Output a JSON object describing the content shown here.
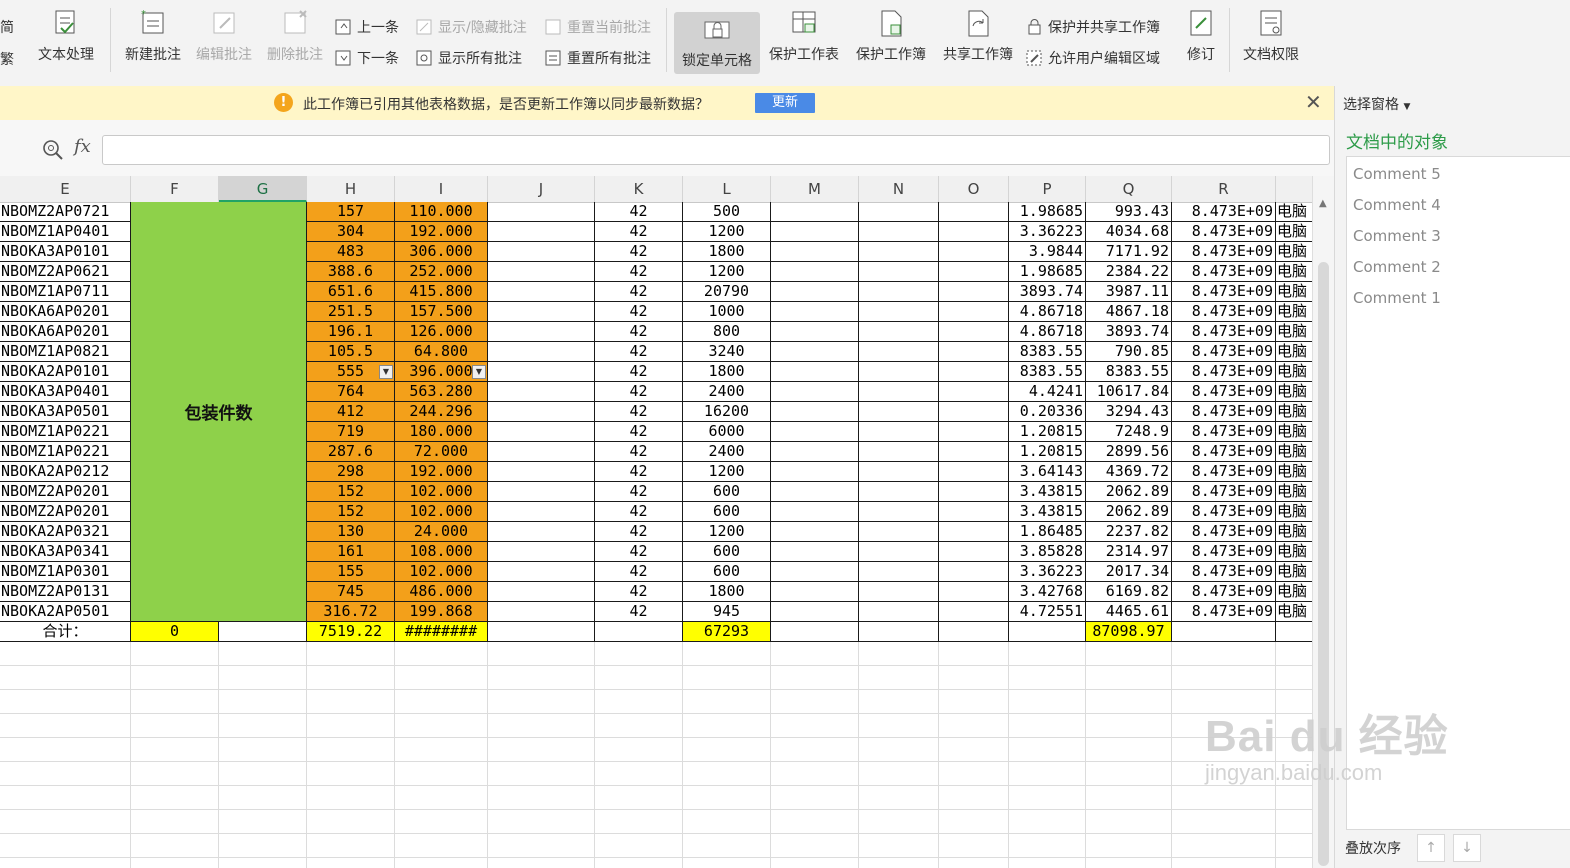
{
  "toolbar": {
    "edge_top": "简",
    "edge_bottom": "繁",
    "text_processing": "文本处理",
    "new_comment": "新建批注",
    "edit_comment": "编辑批注",
    "delete_comment": "删除批注",
    "prev": "上一条",
    "next": "下一条",
    "show_hide_comments": "显示/隐藏批注",
    "show_all_comments": "显示所有批注",
    "reset_current_comment": "重置当前批注",
    "reset_all_comments": "重置所有批注",
    "lock_cells": "锁定单元格",
    "protect_sheet": "保护工作表",
    "protect_workbook": "保护工作簿",
    "share_workbook": "共享工作簿",
    "protect_and_share": "保护并共享工作簿",
    "allow_edit_ranges": "允许用户编辑区域",
    "revise": "修订",
    "doc_permissions": "文档权限"
  },
  "notification": {
    "message": "此工作簿已引用其他表格数据，是否更新工作簿以同步最新数据？",
    "update_button": "更新"
  },
  "formula_bar": {
    "fx": "fx",
    "value": ""
  },
  "columns": [
    "E",
    "F",
    "G",
    "H",
    "I",
    "J",
    "K",
    "L",
    "M",
    "N",
    "O",
    "P",
    "Q",
    "R"
  ],
  "sheet": {
    "merged_label": "包装件数",
    "rows": [
      {
        "e": "NBOMZ2AP0721",
        "h": "157",
        "i": "110.000",
        "k": "42",
        "l": "500",
        "p": "1.98685",
        "q": "993.43",
        "r": "8.473E+09",
        "s": "电脑"
      },
      {
        "e": "NBOMZ1AP0401",
        "h": "304",
        "i": "192.000",
        "k": "42",
        "l": "1200",
        "p": "3.36223",
        "q": "4034.68",
        "r": "8.473E+09",
        "s": "电脑"
      },
      {
        "e": "NBOKA3AP0101",
        "h": "483",
        "i": "306.000",
        "k": "42",
        "l": "1800",
        "p": "3.9844",
        "q": "7171.92",
        "r": "8.473E+09",
        "s": "电脑"
      },
      {
        "e": "NBOMZ2AP0621",
        "h": "388.6",
        "i": "252.000",
        "k": "42",
        "l": "1200",
        "p": "1.98685",
        "q": "2384.22",
        "r": "8.473E+09",
        "s": "电脑"
      },
      {
        "e": "NBOMZ1AP0711",
        "h": "651.6",
        "i": "415.800",
        "k": "42",
        "l": "20790",
        "p": "3893.74",
        "q": "3987.11",
        "r": "8.473E+09",
        "s": "电脑"
      },
      {
        "e": "NBOKA6AP0201",
        "h": "251.5",
        "i": "157.500",
        "k": "42",
        "l": "1000",
        "p": "4.86718",
        "q": "4867.18",
        "r": "8.473E+09",
        "s": "电脑"
      },
      {
        "e": "NBOKA6AP0201",
        "h": "196.1",
        "i": "126.000",
        "k": "42",
        "l": "800",
        "p": "4.86718",
        "q": "3893.74",
        "r": "8.473E+09",
        "s": "电脑"
      },
      {
        "e": "NBOMZ1AP0821",
        "h": "105.5",
        "i": "64.800",
        "k": "42",
        "l": "3240",
        "p": "8383.55",
        "q": "790.85",
        "r": "8.473E+09",
        "s": "电脑"
      },
      {
        "e": "NBOKA2AP0101",
        "h": "555",
        "i": "396.000",
        "k": "42",
        "l": "1800",
        "p": "8383.55",
        "q": "8383.55",
        "r": "8.473E+09",
        "s": "电脑"
      },
      {
        "e": "NBOKA3AP0401",
        "h": "764",
        "i": "563.280",
        "k": "42",
        "l": "2400",
        "p": "4.4241",
        "q": "10617.84",
        "r": "8.473E+09",
        "s": "电脑"
      },
      {
        "e": "NBOKA3AP0501",
        "h": "412",
        "i": "244.296",
        "k": "42",
        "l": "16200",
        "p": "0.20336",
        "q": "3294.43",
        "r": "8.473E+09",
        "s": "电脑"
      },
      {
        "e": "NBOMZ1AP0221",
        "h": "719",
        "i": "180.000",
        "k": "42",
        "l": "6000",
        "p": "1.20815",
        "q": "7248.9",
        "r": "8.473E+09",
        "s": "电脑"
      },
      {
        "e": "NBOMZ1AP0221",
        "h": "287.6",
        "i": "72.000",
        "k": "42",
        "l": "2400",
        "p": "1.20815",
        "q": "2899.56",
        "r": "8.473E+09",
        "s": "电脑"
      },
      {
        "e": "NBOKA2AP0212",
        "h": "298",
        "i": "192.000",
        "k": "42",
        "l": "1200",
        "p": "3.64143",
        "q": "4369.72",
        "r": "8.473E+09",
        "s": "电脑"
      },
      {
        "e": "NBOMZ2AP0201",
        "h": "152",
        "i": "102.000",
        "k": "42",
        "l": "600",
        "p": "3.43815",
        "q": "2062.89",
        "r": "8.473E+09",
        "s": "电脑"
      },
      {
        "e": "NBOMZ2AP0201",
        "h": "152",
        "i": "102.000",
        "k": "42",
        "l": "600",
        "p": "3.43815",
        "q": "2062.89",
        "r": "8.473E+09",
        "s": "电脑"
      },
      {
        "e": "NBOKA2AP0321",
        "h": "130",
        "i": "24.000",
        "k": "42",
        "l": "1200",
        "p": "1.86485",
        "q": "2237.82",
        "r": "8.473E+09",
        "s": "电脑"
      },
      {
        "e": "NBOKA3AP0341",
        "h": "161",
        "i": "108.000",
        "k": "42",
        "l": "600",
        "p": "3.85828",
        "q": "2314.97",
        "r": "8.473E+09",
        "s": "电脑"
      },
      {
        "e": "NBOMZ1AP0301",
        "h": "155",
        "i": "102.000",
        "k": "42",
        "l": "600",
        "p": "3.36223",
        "q": "2017.34",
        "r": "8.473E+09",
        "s": "电脑"
      },
      {
        "e": "NBOMZ2AP0131",
        "h": "745",
        "i": "486.000",
        "k": "42",
        "l": "1800",
        "p": "3.42768",
        "q": "6169.82",
        "r": "8.473E+09",
        "s": "电脑"
      },
      {
        "e": "NBOKA2AP0501",
        "h": "316.72",
        "i": "199.868",
        "k": "42",
        "l": "945",
        "p": "4.72551",
        "q": "4465.61",
        "r": "8.473E+09",
        "s": "电脑"
      }
    ],
    "totals": {
      "label": "合计：",
      "f": "0",
      "h": "7519.22",
      "i": "########",
      "l": "67293",
      "q": "87098.97"
    }
  },
  "side_pane": {
    "title": "选择窗格",
    "subtitle": "文档中的对象",
    "items": [
      "Comment 5",
      "Comment 4",
      "Comment 3",
      "Comment 2",
      "Comment 1"
    ],
    "footer": "叠放次序"
  },
  "watermark": {
    "brand": "Bai du 经验",
    "url": "jingyan.baidu.com"
  },
  "colors": {
    "orange": "#f3a01a",
    "green": "#8ed14a",
    "yellow": "#ffff00",
    "accent": "#2c9b48",
    "notify": "#fff6c8"
  }
}
